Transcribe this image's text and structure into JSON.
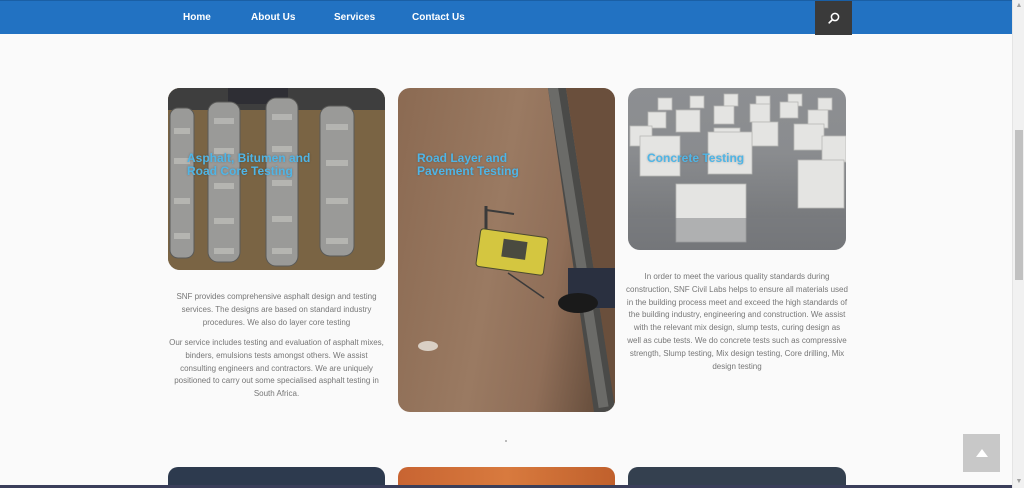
{
  "nav": {
    "items": [
      "Home",
      "About Us",
      "Services",
      "Contact Us"
    ]
  },
  "icons": {
    "search": "search-icon",
    "back_to_top": "chevron-up-icon"
  },
  "colors": {
    "nav_bg": "#2272c2",
    "card_title": "#4fb5e6",
    "body_text": "#777777"
  },
  "services": [
    {
      "title_lines": [
        "Asphalt, Bitumen and",
        "Road Core Testing"
      ],
      "paragraphs": [
        "SNF provides comprehensive asphalt design and testing services. The designs are based on standard industry procedures. We also do layer core testing",
        "Our service includes testing and evaluation of asphalt mixes, binders, emulsions tests amongst others. We assist consulting engineers and contractors. We are uniquely positioned to carry out some specialised asphalt testing in South Africa."
      ]
    },
    {
      "title_lines": [
        "Road Layer and",
        "Pavement Testing"
      ]
    },
    {
      "title_lines": [
        "Concrete Testing"
      ],
      "paragraphs": [
        "In order to meet the various quality standards during construction, SNF Civil Labs helps to ensure all materials used in the building process meet and exceed the high standards of the building industry, engineering and construction. We assist with the relevant mix design, slump tests, curing design as well as cube tests. We do concrete tests such as compressive strength, Slump testing, Mix design testing, Core drilling, Mix design testing"
      ]
    }
  ]
}
